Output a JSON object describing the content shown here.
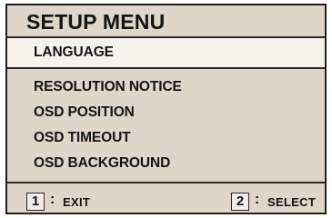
{
  "menu": {
    "title": "SETUP MENU",
    "selected_item": "LANGUAGE",
    "items": [
      "RESOLUTION NOTICE",
      "OSD POSITION",
      "OSD TIMEOUT",
      "OSD BACKGROUND"
    ]
  },
  "footer": {
    "exit_key": "1",
    "exit_separator": ":",
    "exit_label": "EXIT",
    "select_key": "2",
    "select_separator": ":",
    "select_label": "SELECT"
  },
  "colors": {
    "panel_background": "#ded7c9",
    "selected_background": "#f6f3ec",
    "text": "#141414",
    "border": "#1e1e1e"
  }
}
